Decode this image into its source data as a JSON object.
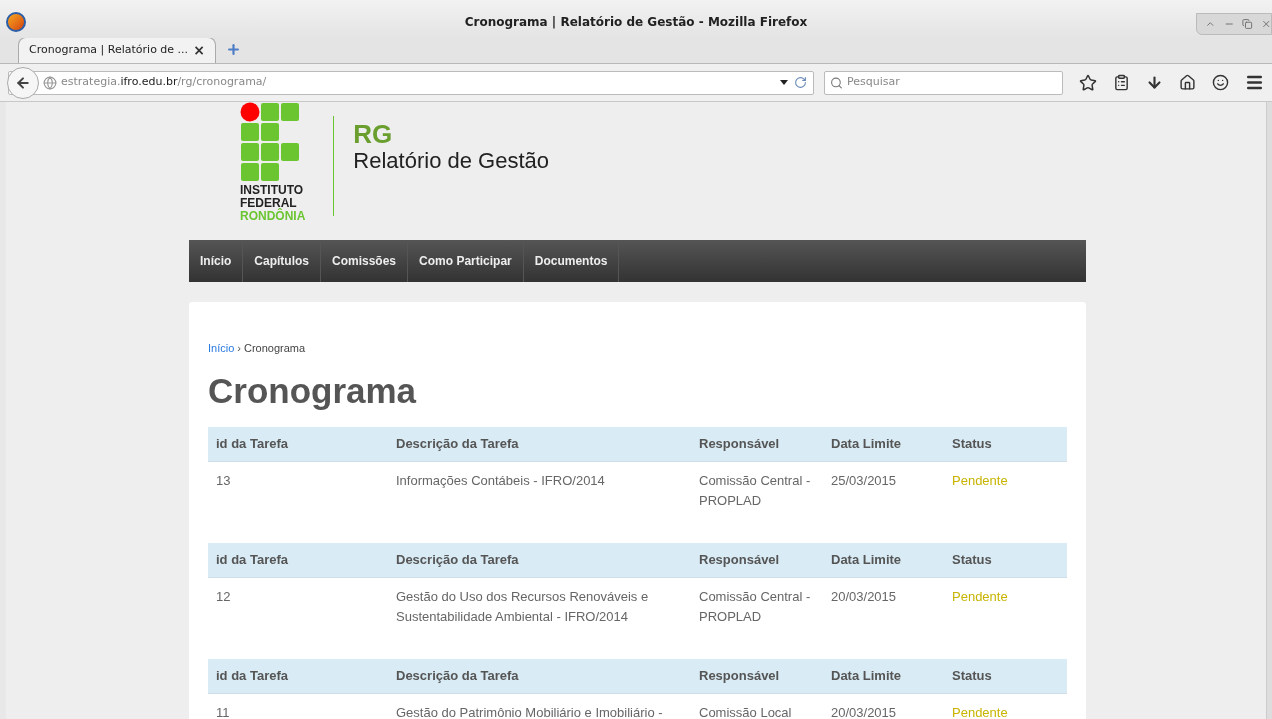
{
  "window": {
    "title": "Cronograma | Relatório de Gestão - Mozilla Firefox"
  },
  "tabs": [
    {
      "label": "Cronograma | Relatório de ...",
      "close": "×",
      "selected": true
    }
  ],
  "address_bar": {
    "url_host_prefix": "estrategia.",
    "url_domain": "ifro.edu.br",
    "url_path": "/rg/cronograma/"
  },
  "search": {
    "placeholder": "Pesquisar"
  },
  "site": {
    "logo_lines": [
      "INSTITUTO",
      "FEDERAL"
    ],
    "logo_region": "RONDÔNIA",
    "acronym": "RG",
    "name": "Relatório de Gestão"
  },
  "nav": [
    {
      "label": "Início"
    },
    {
      "label": "Capítulos"
    },
    {
      "label": "Comissões"
    },
    {
      "label": "Como Participar"
    },
    {
      "label": "Documentos"
    }
  ],
  "breadcrumb": {
    "link": "Início",
    "separator": "›",
    "current": "Cronograma"
  },
  "heading": "Cronograma",
  "tables": [
    {
      "columns": [
        "id da Tarefa",
        "Descrição da Tarefa",
        "Responsável",
        "Data Limite",
        "Status"
      ],
      "row": {
        "id": "13",
        "description": "Informações Contábeis - IFRO/2014",
        "responsible": "Comissão Central - PROPLAD",
        "deadline": "25/03/2015",
        "status": "Pendente",
        "color": "#c8b400"
      }
    },
    {
      "columns": [
        "id da Tarefa",
        "Descrição da Tarefa",
        "Responsável",
        "Data Limite",
        "Status"
      ],
      "row": {
        "id": "12",
        "description": "Gestão do Uso dos Recursos Renováveis e Sustentabilidade Ambiental - IFRO/2014",
        "responsible": "Comissão Central - PROPLAD",
        "deadline": "20/03/2015",
        "status": "Pendente",
        "color": "#c8b400"
      }
    },
    {
      "columns": [
        "id da Tarefa",
        "Descrição da Tarefa",
        "Responsável",
        "Data Limite",
        "Status"
      ],
      "row": {
        "id": "11",
        "description": "Gestão do Patrimônio Mobiliário e Imobiliário -",
        "responsible": "Comissão Local",
        "deadline": "20/03/2015",
        "status": "Pendente",
        "color": "#c8b400"
      }
    }
  ]
}
